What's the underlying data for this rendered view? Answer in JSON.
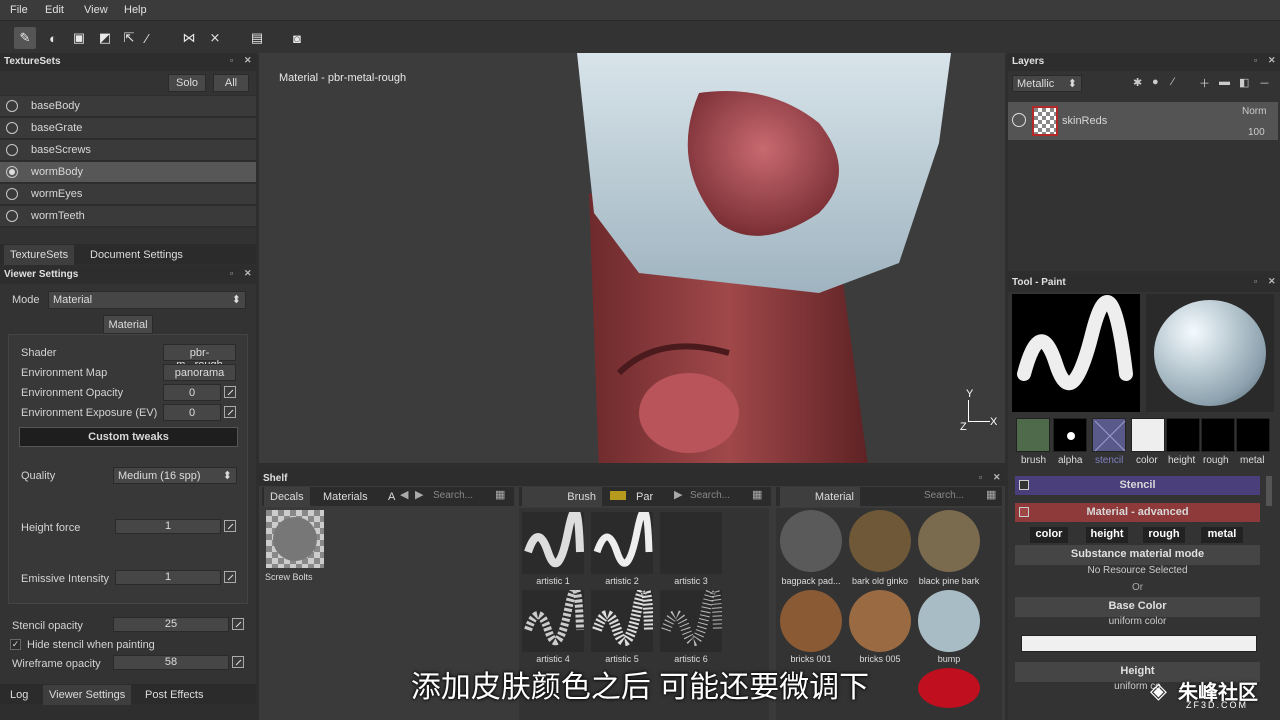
{
  "menu": [
    "File",
    "Edit",
    "View",
    "Help"
  ],
  "texturesets": {
    "title": "TextureSets",
    "solo": "Solo",
    "all": "All",
    "items": [
      "baseBody",
      "baseGrate",
      "baseScrews",
      "wormBody",
      "wormEyes",
      "wormTeeth"
    ],
    "tabs": [
      "TextureSets",
      "Document Settings"
    ]
  },
  "viewer": {
    "title": "Viewer Settings",
    "mode_label": "Mode",
    "mode_value": "Material",
    "material_btn": "Material",
    "shader_label": "Shader",
    "shader_value": "pbr-m...rough",
    "envmap_label": "Environment Map",
    "envmap_value": "panorama",
    "envop_label": "Environment Opacity",
    "envop_value": "0",
    "envexp_label": "Environment Exposure (EV)",
    "envexp_value": "0",
    "custom_tweaks": "Custom tweaks",
    "quality_label": "Quality",
    "quality_value": "Medium (16 spp)",
    "height_label": "Height force",
    "height_value": "1",
    "emissive_label": "Emissive Intensity",
    "emissive_value": "1",
    "stencil_label": "Stencil opacity",
    "stencil_value": "25",
    "hide_stencil": "Hide stencil when painting",
    "wire_label": "Wireframe opacity",
    "wire_value": "58",
    "bottom_tabs": [
      "Log",
      "Viewer Settings",
      "Post Effects"
    ]
  },
  "viewport": {
    "label": "Material - pbr-metal-rough",
    "axis_y": "Y",
    "axis_z": "Z",
    "axis_x": "X"
  },
  "shelf": {
    "title": "Shelf",
    "left_tabs": [
      "Decals",
      "Materials",
      "A"
    ],
    "search": "Search...",
    "decals": [
      {
        "label": "Screw Bolts"
      }
    ],
    "brush_tab": "Brush",
    "par_tab": "Par",
    "brushes": [
      "artistic 1",
      "artistic 2",
      "artistic 3",
      "artistic 4",
      "artistic 5",
      "artistic 6"
    ],
    "material_tab": "Material",
    "materials": [
      "bagpack pad...",
      "bark old ginko",
      "black pine bark",
      "bricks 001",
      "bricks 005",
      "bump"
    ]
  },
  "layers": {
    "title": "Layers",
    "channel": "Metallic",
    "layer_name": "skinReds",
    "blend": "Norm",
    "opacity": "100"
  },
  "toolpaint": {
    "title": "Tool - Paint",
    "chips": [
      "brush",
      "alpha",
      "stencil",
      "color",
      "height",
      "rough",
      "metal"
    ],
    "stencil_header": "Stencil",
    "material_header": "Material - advanced",
    "channels": [
      "color",
      "height",
      "rough",
      "metal"
    ],
    "mode_label": "Substance material mode",
    "no_resource": "No Resource Selected",
    "or": "Or",
    "base_color": "Base Color",
    "uniform": "uniform color",
    "height": "Height",
    "uniform2": "uniform co"
  },
  "subtitle": "添加皮肤颜色之后 可能还要微调下",
  "watermark": "朱峰社区",
  "watermark_url": "ZF3D.COM"
}
